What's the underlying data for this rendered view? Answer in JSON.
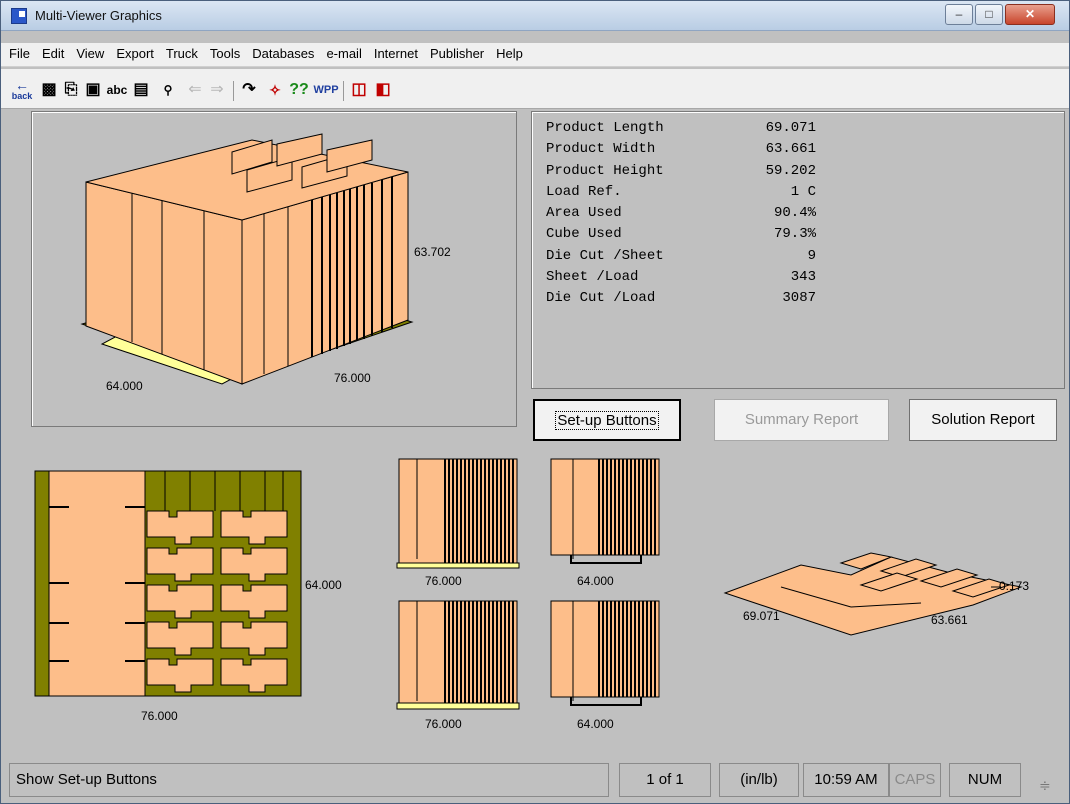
{
  "window": {
    "title": "Multi-Viewer Graphics"
  },
  "menu": [
    "File",
    "Edit",
    "View",
    "Export",
    "Truck",
    "Tools",
    "Databases",
    "e-mail",
    "Internet",
    "Publisher",
    "Help"
  ],
  "toolbar": {
    "back_label": "back",
    "spell_label": "abc",
    "hidden_label": "??",
    "wpp_label": "WPP"
  },
  "info": {
    "rows": [
      {
        "label": "Product Length",
        "value": "69.071"
      },
      {
        "label": "Product Width",
        "value": "63.661"
      },
      {
        "label": "Product Height",
        "value": "59.202"
      },
      {
        "label": "Load Ref.",
        "value": "1 C"
      },
      {
        "label": "Area Used",
        "value": "90.4%"
      },
      {
        "label": "Cube Used",
        "value": "79.3%"
      },
      {
        "label": "Die Cut /Sheet",
        "value": "9"
      },
      {
        "label": "Sheet /Load",
        "value": "343"
      },
      {
        "label": "Die Cut /Load",
        "value": "3087"
      }
    ]
  },
  "buttons": {
    "setup": "Set-up Buttons",
    "summary": "Summary Report",
    "solution": "Solution Report"
  },
  "views": {
    "iso_height": "63.702",
    "iso_width": "64.000",
    "iso_length": "76.000",
    "top_width": "64.000",
    "top_length": "76.000",
    "side1_length": "76.000",
    "side2_width": "64.000",
    "side3_length": "76.000",
    "side4_width": "64.000",
    "product_length": "69.071",
    "product_width": "63.661",
    "product_thickness": "0.173"
  },
  "status": {
    "message": "Show Set-up Buttons",
    "page": "1 of 1",
    "units": "(in/lb)",
    "time": "10:59 AM",
    "caps": "CAPS",
    "num": "NUM"
  },
  "colors": {
    "product": "#fdbe8a",
    "pallet": "#808000",
    "pallet_wood": "#ffff99"
  }
}
